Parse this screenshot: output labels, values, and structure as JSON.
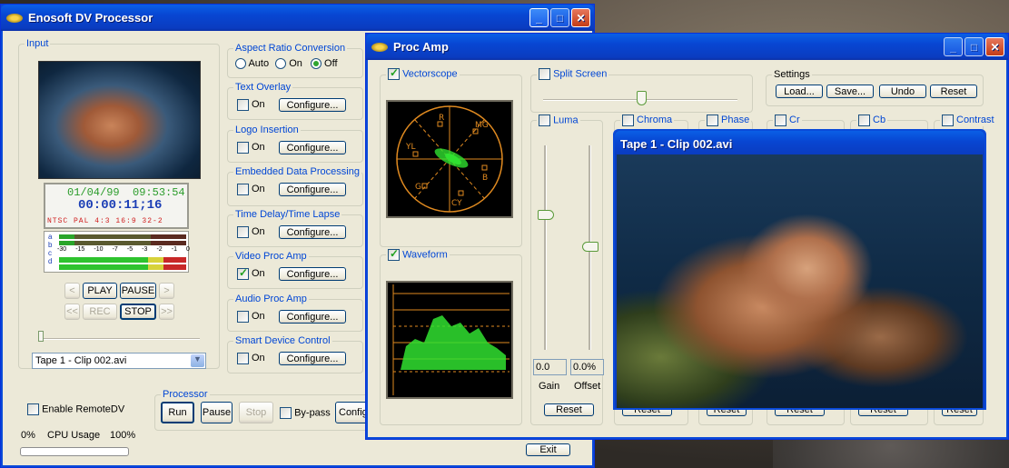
{
  "main_window": {
    "title": "Enosoft DV Processor",
    "input": {
      "legend": "Input",
      "date": "01/04/99",
      "time": "09:53:54",
      "timecode": "00:00:11;16",
      "status_line": "NTSC PAL 4:3 16:9 32-2",
      "meter_scale": [
        "-30",
        "-15",
        "-10",
        "-7",
        "-5",
        "-3",
        "-2",
        "-1",
        "0"
      ],
      "meter_channels": [
        "a",
        "b",
        "c",
        "d"
      ],
      "transport": {
        "prev": "<",
        "play": "PLAY",
        "pause": "PAUSE",
        "next": ">",
        "rew": "<<",
        "rec": "REC",
        "stop": "STOP",
        "ffwd": ">>"
      },
      "source_select": "Tape 1 - Clip 002.avi"
    },
    "aspect": {
      "legend": "Aspect Ratio Conversion",
      "auto": "Auto",
      "on": "On",
      "off": "Off"
    },
    "effects": [
      {
        "legend": "Text Overlay",
        "on": "On",
        "configure": "Configure..."
      },
      {
        "legend": "Logo Insertion",
        "on": "On",
        "configure": "Configure..."
      },
      {
        "legend": "Embedded Data Processing",
        "on": "On",
        "configure": "Configure..."
      },
      {
        "legend": "Time Delay/Time Lapse",
        "on": "On",
        "configure": "Configure..."
      },
      {
        "legend": "Video Proc Amp",
        "on": "On",
        "configure": "Configure..."
      },
      {
        "legend": "Audio Proc Amp",
        "on": "On",
        "configure": "Configure..."
      },
      {
        "legend": "Smart Device Control",
        "on": "On",
        "configure": "Configure..."
      }
    ],
    "enable_remote": "Enable RemoteDV",
    "cpu": {
      "min": "0%",
      "label": "CPU Usage",
      "max": "100%"
    },
    "processor": {
      "legend": "Processor",
      "run": "Run",
      "pause": "Pause",
      "stop": "Stop",
      "bypass": "By-pass",
      "config": "Config"
    }
  },
  "proc_amp": {
    "title": "Proc Amp",
    "vectorscope": {
      "label": "Vectorscope",
      "targets": [
        "R",
        "MG",
        "B",
        "CY",
        "G",
        "YL"
      ]
    },
    "waveform": {
      "label": "Waveform"
    },
    "split_screen": "Split Screen",
    "settings": {
      "legend": "Settings",
      "load": "Load...",
      "save": "Save...",
      "undo": "Undo",
      "reset": "Reset"
    },
    "channels": [
      "Luma",
      "Chroma",
      "Phase",
      "Cr",
      "Cb",
      "Contrast"
    ],
    "luma": {
      "gain_value": "0.0",
      "offset_value": "0.0%",
      "gain": "Gain",
      "offset": "Offset",
      "reset": "Reset"
    },
    "reset_label": "Reset",
    "exit": "Exit"
  },
  "preview_window": {
    "title": "Tape 1 - Clip 002.avi"
  }
}
